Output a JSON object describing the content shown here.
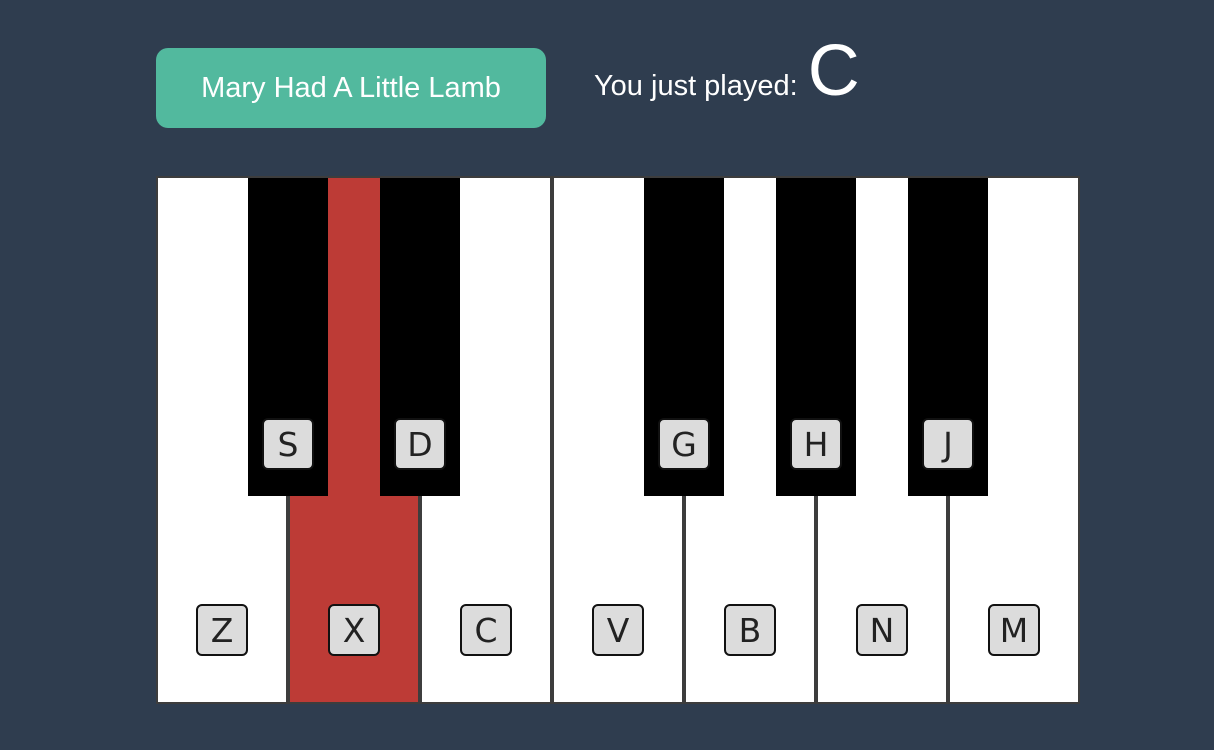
{
  "song_button": {
    "label": "Mary Had A Little Lamb"
  },
  "status": {
    "label": "You just played:",
    "note": "C"
  },
  "piano": {
    "white_keys": [
      {
        "key": "Z",
        "active": false
      },
      {
        "key": "X",
        "active": true
      },
      {
        "key": "C",
        "active": false
      },
      {
        "key": "V",
        "active": false
      },
      {
        "key": "B",
        "active": false
      },
      {
        "key": "N",
        "active": false
      },
      {
        "key": "M",
        "active": false
      }
    ],
    "black_keys": [
      {
        "key": "S",
        "active": false
      },
      {
        "key": "D",
        "active": false
      },
      {
        "key": "G",
        "active": false
      },
      {
        "key": "H",
        "active": false
      },
      {
        "key": "J",
        "active": false
      }
    ],
    "colors": {
      "active": "#bd3b36",
      "white": "#ffffff",
      "black": "#000000",
      "background": "#2f3d4f",
      "button": "#52b99e"
    }
  }
}
